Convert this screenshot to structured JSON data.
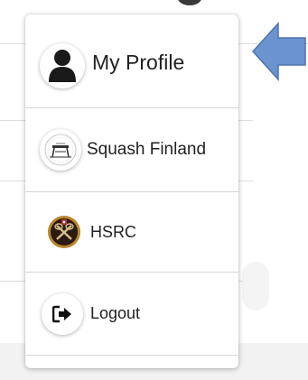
{
  "menu": {
    "items": [
      {
        "label": "My Profile",
        "icon": "user-icon"
      },
      {
        "label": "Squash Finland",
        "icon": "squash-finland-logo-icon"
      },
      {
        "label": "HSRC",
        "icon": "hsrc-logo-icon"
      },
      {
        "label": "Logout",
        "icon": "logout-icon"
      }
    ]
  },
  "arrow": {
    "color": "#6b93cf",
    "icon": "left-arrow-icon"
  }
}
